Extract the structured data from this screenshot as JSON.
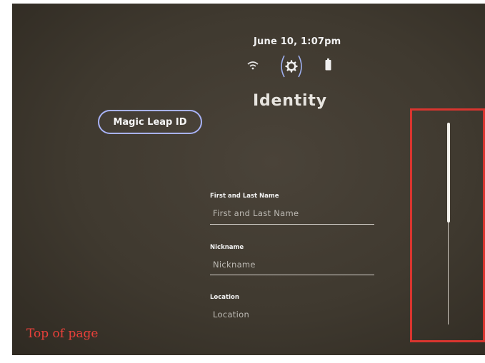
{
  "status": {
    "date_time": "June 10, 1:07pm"
  },
  "icons": {
    "wifi": "wifi-icon",
    "settings": "gear-icon",
    "battery": "battery-icon"
  },
  "header": {
    "title": "Identity"
  },
  "id_button": {
    "label": "Magic Leap ID"
  },
  "form": {
    "fields": [
      {
        "label": "First and Last Name",
        "placeholder": "First and Last Name"
      },
      {
        "label": "Nickname",
        "placeholder": "Nickname"
      },
      {
        "label": "Location",
        "placeholder": "Location"
      }
    ]
  },
  "scrollbar": {
    "position_fraction": 0.0
  },
  "annotation": {
    "text": "Top of page",
    "color": "#d9352f"
  },
  "colors": {
    "accent_outline": "#a8b2f6",
    "background": "#3f392f"
  }
}
